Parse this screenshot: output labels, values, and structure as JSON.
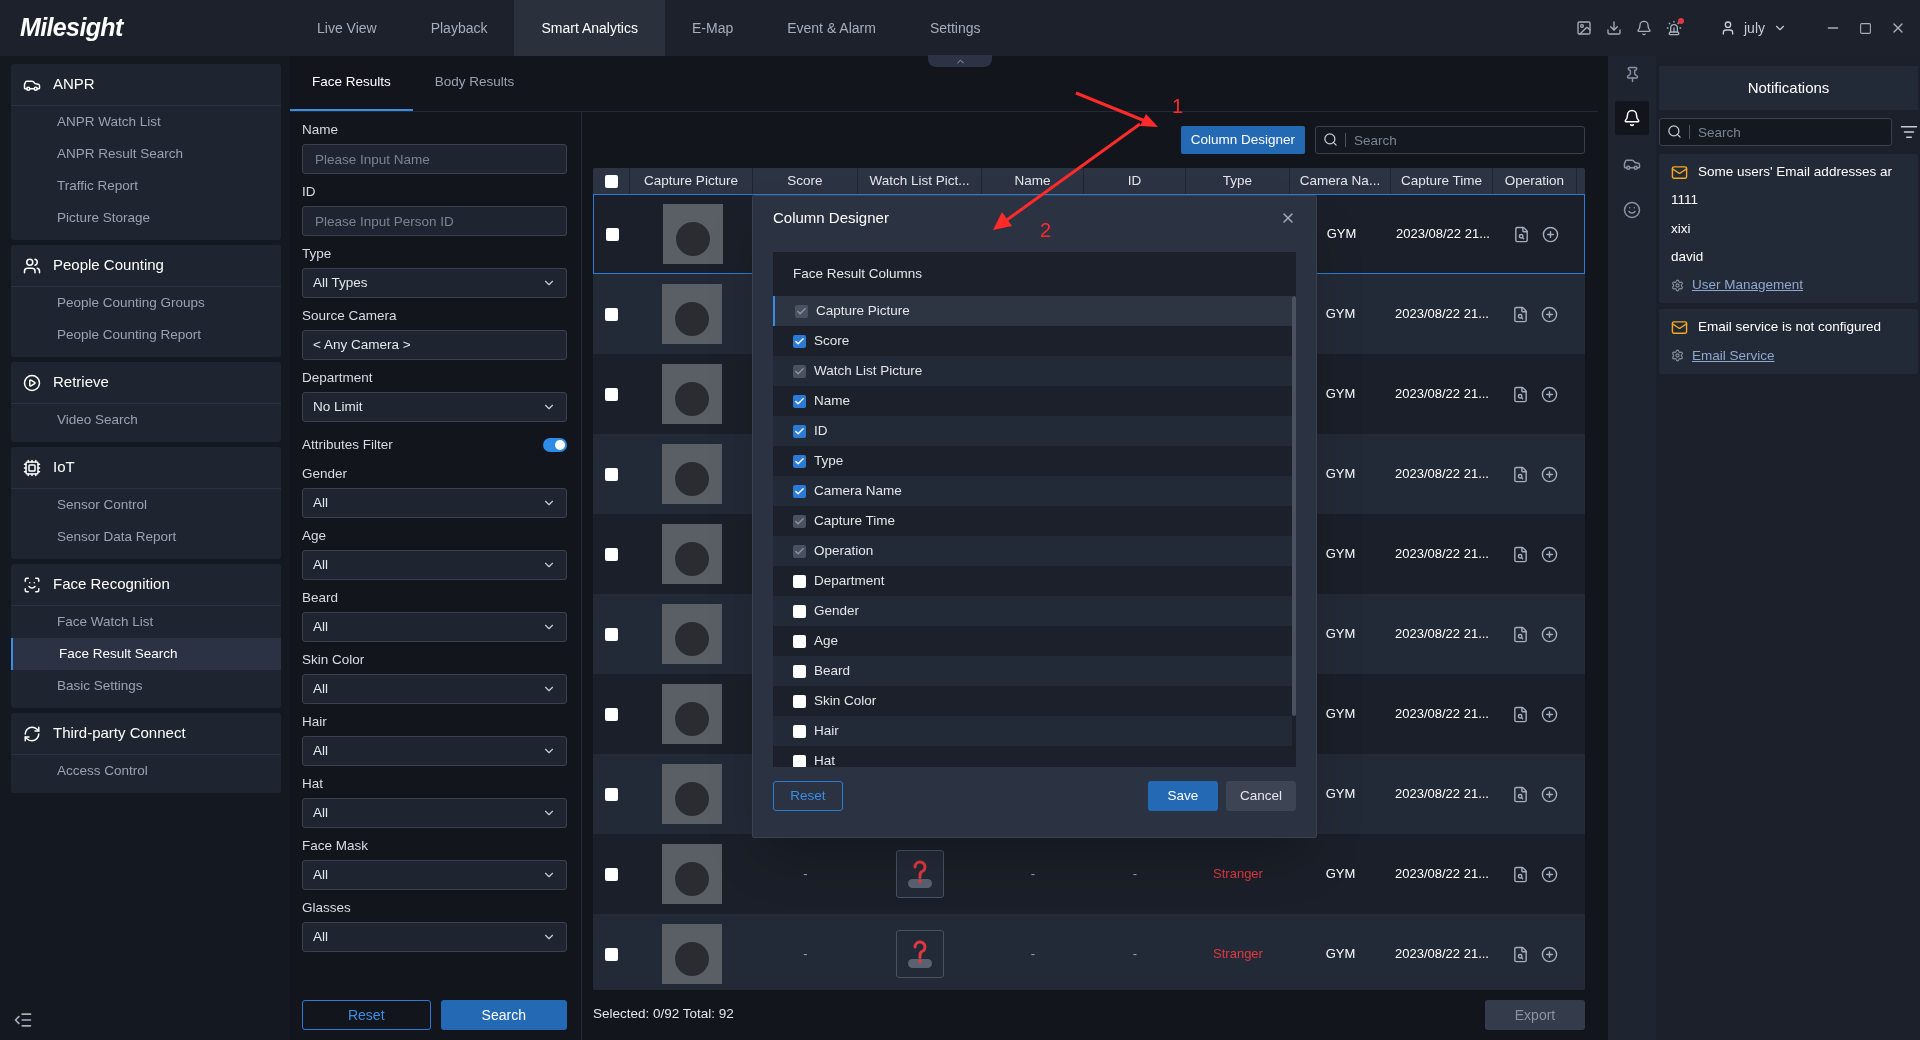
{
  "app": {
    "logo": "Milesight",
    "user": "july"
  },
  "nav_tabs": [
    {
      "label": "Live View",
      "selected": false
    },
    {
      "label": "Playback",
      "selected": false
    },
    {
      "label": "Smart Analytics",
      "selected": true
    },
    {
      "label": "E-Map",
      "selected": false
    },
    {
      "label": "Event & Alarm",
      "selected": false
    },
    {
      "label": "Settings",
      "selected": false
    }
  ],
  "sidebar": {
    "groups": [
      {
        "title": "ANPR",
        "items": [
          {
            "label": "ANPR Watch List",
            "selected": false
          },
          {
            "label": "ANPR Result Search",
            "selected": false
          },
          {
            "label": "Traffic Report",
            "selected": false
          },
          {
            "label": "Picture Storage",
            "selected": false
          }
        ]
      },
      {
        "title": "People Counting",
        "items": [
          {
            "label": "People Counting Groups",
            "selected": false
          },
          {
            "label": "People Counting Report",
            "selected": false
          }
        ]
      },
      {
        "title": "Retrieve",
        "items": [
          {
            "label": "Video Search",
            "selected": false
          }
        ]
      },
      {
        "title": "IoT",
        "items": [
          {
            "label": "Sensor Control",
            "selected": false
          },
          {
            "label": "Sensor Data Report",
            "selected": false
          }
        ]
      },
      {
        "title": "Face Recognition",
        "items": [
          {
            "label": "Face Watch List",
            "selected": false
          },
          {
            "label": "Face Result Search",
            "selected": true
          },
          {
            "label": "Basic Settings",
            "selected": false
          }
        ]
      },
      {
        "title": "Third-party Connect",
        "items": [
          {
            "label": "Access Control",
            "selected": false
          }
        ]
      }
    ]
  },
  "result_tabs": [
    {
      "label": "Face Results",
      "selected": true
    },
    {
      "label": "Body Results",
      "selected": false
    }
  ],
  "filters": {
    "fields": [
      {
        "label": "Name",
        "kind": "input",
        "placeholder": "Please Input Name"
      },
      {
        "label": "ID",
        "kind": "input",
        "placeholder": "Please Input Person ID"
      },
      {
        "label": "Type",
        "kind": "select",
        "value": "All Types"
      },
      {
        "label": "Source Camera",
        "kind": "picker",
        "value": "< Any Camera >"
      },
      {
        "label": "Department",
        "kind": "select",
        "value": "No Limit"
      },
      {
        "label": "Attributes Filter",
        "kind": "toggle",
        "on": true
      },
      {
        "label": "Gender",
        "kind": "select",
        "value": "All"
      },
      {
        "label": "Age",
        "kind": "select",
        "value": "All"
      },
      {
        "label": "Beard",
        "kind": "select",
        "value": "All"
      },
      {
        "label": "Skin Color",
        "kind": "select",
        "value": "All"
      },
      {
        "label": "Hair",
        "kind": "select",
        "value": "All"
      },
      {
        "label": "Hat",
        "kind": "select",
        "value": "All"
      },
      {
        "label": "Face Mask",
        "kind": "select",
        "value": "All"
      },
      {
        "label": "Glasses",
        "kind": "select",
        "value": "All"
      }
    ],
    "reset": "Reset",
    "search": "Search"
  },
  "toolbar": {
    "column_designer": "Column Designer",
    "search_placeholder": "Search"
  },
  "table": {
    "header_checked": false,
    "columns": [
      "Capture Picture",
      "Score",
      "Watch List Pict...",
      "Name",
      "ID",
      "Type",
      "Camera Na...",
      "Capture Time",
      "Operation"
    ],
    "rows": [
      {
        "selected": true,
        "checked": false,
        "camera": "GYM",
        "time": "2023/08/22 21..."
      },
      {
        "selected": false,
        "checked": false,
        "camera": "GYM",
        "time": "2023/08/22 21..."
      },
      {
        "selected": false,
        "checked": false,
        "camera": "GYM",
        "time": "2023/08/22 21..."
      },
      {
        "selected": false,
        "checked": false,
        "camera": "GYM",
        "time": "2023/08/22 21..."
      },
      {
        "selected": false,
        "checked": false,
        "camera": "GYM",
        "time": "2023/08/22 21..."
      },
      {
        "selected": false,
        "checked": false,
        "camera": "GYM",
        "time": "2023/08/22 21..."
      },
      {
        "selected": false,
        "checked": false,
        "camera": "GYM",
        "time": "2023/08/22 21..."
      },
      {
        "selected": false,
        "checked": false,
        "camera": "GYM",
        "time": "2023/08/22 21..."
      },
      {
        "selected": false,
        "checked": false,
        "score": "-",
        "watch_list_unknown": true,
        "name": "-",
        "id": "-",
        "type": "Stranger",
        "camera": "GYM",
        "time": "2023/08/22 21..."
      },
      {
        "selected": false,
        "checked": false,
        "score": "-",
        "watch_list_unknown": true,
        "name": "-",
        "id": "-",
        "type": "Stranger",
        "camera": "GYM",
        "time": "2023/08/22 21..."
      }
    ],
    "footer": "Selected: 0/92 Total: 92",
    "export": "Export"
  },
  "dialog": {
    "title": "Column Designer",
    "section": "Face Result Columns",
    "columns": [
      {
        "label": "Capture Picture",
        "checked": true,
        "disabled": true,
        "selected": true
      },
      {
        "label": "Score",
        "checked": true,
        "disabled": false,
        "selected": false
      },
      {
        "label": "Watch List Picture",
        "checked": true,
        "disabled": true,
        "selected": false
      },
      {
        "label": "Name",
        "checked": true,
        "disabled": false,
        "selected": false
      },
      {
        "label": "ID",
        "checked": true,
        "disabled": false,
        "selected": false
      },
      {
        "label": "Type",
        "checked": true,
        "disabled": false,
        "selected": false
      },
      {
        "label": "Camera Name",
        "checked": true,
        "disabled": false,
        "selected": false
      },
      {
        "label": "Capture Time",
        "checked": true,
        "disabled": true,
        "selected": false
      },
      {
        "label": "Operation",
        "checked": true,
        "disabled": true,
        "selected": false
      },
      {
        "label": "Department",
        "checked": false,
        "disabled": false,
        "selected": false
      },
      {
        "label": "Gender",
        "checked": false,
        "disabled": false,
        "selected": false
      },
      {
        "label": "Age",
        "checked": false,
        "disabled": false,
        "selected": false
      },
      {
        "label": "Beard",
        "checked": false,
        "disabled": false,
        "selected": false
      },
      {
        "label": "Skin Color",
        "checked": false,
        "disabled": false,
        "selected": false
      },
      {
        "label": "Hair",
        "checked": false,
        "disabled": false,
        "selected": false
      },
      {
        "label": "Hat",
        "checked": false,
        "disabled": false,
        "selected": false
      }
    ],
    "reset": "Reset",
    "save": "Save",
    "cancel": "Cancel"
  },
  "side_strip": [
    {
      "selected": true
    },
    {
      "selected": false
    },
    {
      "selected": false
    }
  ],
  "notifications": {
    "title": "Notifications",
    "search_placeholder": "Search",
    "items": [
      {
        "message": "Some users' Email addresses ar",
        "lines": [
          "1111",
          "xixi",
          "david"
        ],
        "link": "User Management"
      },
      {
        "message": "Email service is not configured",
        "link": "Email Service"
      }
    ]
  },
  "annotations": [
    "1",
    "2"
  ]
}
